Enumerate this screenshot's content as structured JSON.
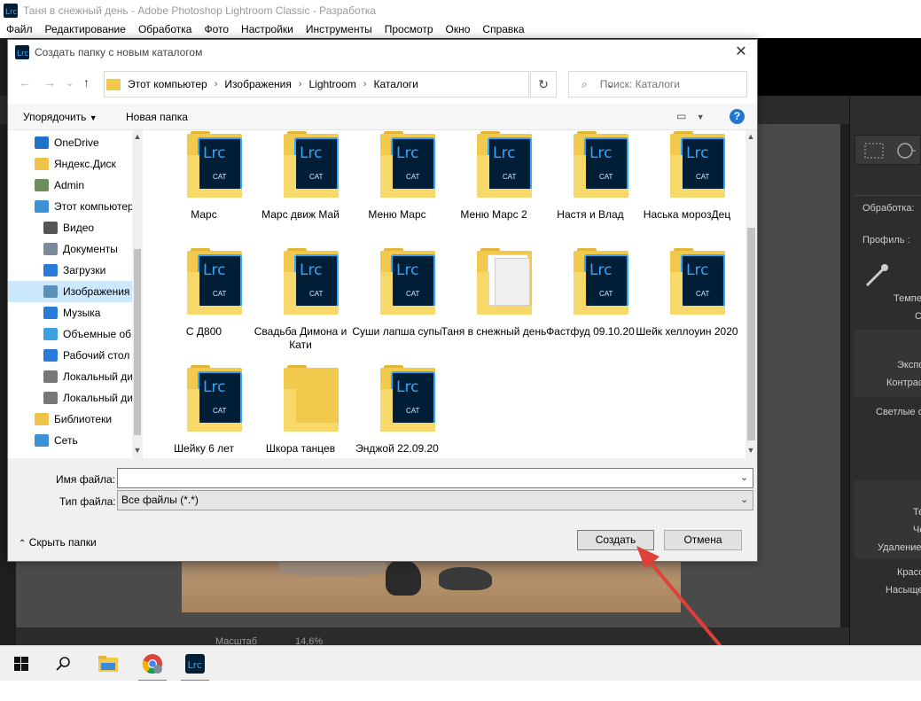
{
  "app": {
    "window_title": "Таня в снежный день - Adobe Photoshop Lightroom Classic - Разработка",
    "menu": [
      "Файл",
      "Редактирование",
      "Обработка",
      "Фото",
      "Настройки",
      "Инструменты",
      "Просмотр",
      "Окно",
      "Справка"
    ],
    "right_panel": {
      "processing_label": "Обработка:",
      "profile_label": "Профиль :",
      "labels": [
        "Темпе",
        "С",
        "Экспо",
        "Контрас",
        "Светлые о",
        "Те",
        "Че",
        "Удаление",
        "Красо",
        "Насыще"
      ]
    },
    "bottom_bar": {
      "zoom_label": "Масштаб",
      "zoom_value": "14,6%"
    }
  },
  "dialog": {
    "title": "Создать папку с новым каталогом",
    "close_label": "✕",
    "breadcrumbs": [
      "Этот компьютер",
      "Изображения",
      "Lightroom",
      "Каталоги"
    ],
    "search_placeholder": "Поиск: Каталоги",
    "toolbar": {
      "organize_label": "Упорядочить",
      "new_folder_label": "Новая папка",
      "help_label": "?"
    },
    "nav_items": [
      {
        "label": "OneDrive",
        "icon": "cloud-icon",
        "color": "#1e73c8"
      },
      {
        "label": "Яндекс.Диск",
        "icon": "yandex-disk-icon",
        "color": "#f0c24a"
      },
      {
        "label": "Admin",
        "icon": "user-icon",
        "color": "#6b8e5a"
      },
      {
        "label": "Этот компьютер",
        "icon": "computer-icon",
        "color": "#3d8fd6"
      },
      {
        "label": "Видео",
        "icon": "video-icon",
        "color": "#555555"
      },
      {
        "label": "Документы",
        "icon": "documents-icon",
        "color": "#7a8a9a"
      },
      {
        "label": "Загрузки",
        "icon": "downloads-icon",
        "color": "#2a7ad8"
      },
      {
        "label": "Изображения",
        "icon": "pictures-icon",
        "color": "#5a8fb8"
      },
      {
        "label": "Музыка",
        "icon": "music-icon",
        "color": "#2a7ad8"
      },
      {
        "label": "Объемные об",
        "icon": "3d-objects-icon",
        "color": "#3aa0e0"
      },
      {
        "label": "Рабочий стол",
        "icon": "desktop-icon",
        "color": "#2a7ad8"
      },
      {
        "label": "Локальный ди",
        "icon": "drive-icon",
        "color": "#777777"
      },
      {
        "label": "Локальный ди",
        "icon": "drive-icon",
        "color": "#777777"
      },
      {
        "label": "Библиотеки",
        "icon": "libraries-icon",
        "color": "#f0c24a"
      },
      {
        "label": "Сеть",
        "icon": "network-icon",
        "color": "#3d8fd6"
      }
    ],
    "files": [
      {
        "name": "Марс",
        "type": "lrc"
      },
      {
        "name": "Марс движ Май",
        "type": "lrc"
      },
      {
        "name": "Меню Марс",
        "type": "lrc"
      },
      {
        "name": "Меню Марс 2",
        "type": "lrc"
      },
      {
        "name": "Настя и Влад",
        "type": "lrc"
      },
      {
        "name": "Наська морозДец",
        "type": "lrc"
      },
      {
        "name": "С Д800",
        "type": "lrc"
      },
      {
        "name": "Свадьба Димона и Кати",
        "type": "lrc"
      },
      {
        "name": "Суши лапша супы",
        "type": "lrc"
      },
      {
        "name": "Таня в снежный день",
        "type": "docs"
      },
      {
        "name": "Фастфуд 09.10.20",
        "type": "lrc"
      },
      {
        "name": "Шейк хеллоуин 2020",
        "type": "lrc"
      },
      {
        "name": "Шейку 6 лет",
        "type": "lrc"
      },
      {
        "name": "Шкора танцев",
        "type": "empty"
      },
      {
        "name": "Энджой 22.09.20",
        "type": "lrc"
      }
    ],
    "lrc_label": "Lrc",
    "cat_label": "CAT",
    "filename_label": "Имя файла:",
    "filename_value": "",
    "filetype_label": "Тип файла:",
    "filetype_value": "Все файлы (*.*)",
    "hide_folders_label": "Скрыть папки",
    "create_label": "Создать",
    "cancel_label": "Отмена"
  },
  "taskbar": [
    "start-icon",
    "search-icon",
    "file-explorer-icon",
    "chrome-icon",
    "lightroom-icon"
  ],
  "colors": {
    "accent": "#0078d7",
    "folder": "#f1c94d",
    "lrc_blue": "#31a8ff",
    "lrc_bg": "#001e36",
    "arrow": "#e0403a"
  }
}
